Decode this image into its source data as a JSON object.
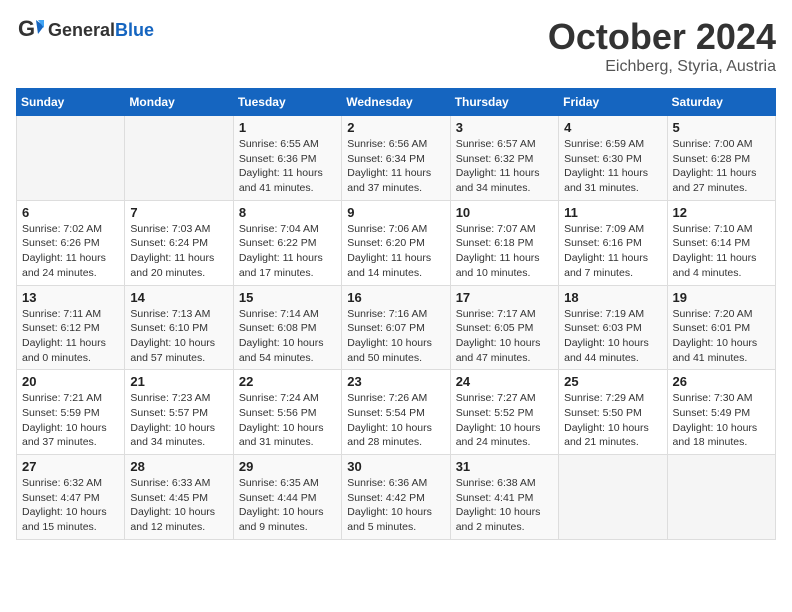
{
  "header": {
    "logo_general": "General",
    "logo_blue": "Blue",
    "month_title": "October 2024",
    "location": "Eichberg, Styria, Austria"
  },
  "days_of_week": [
    "Sunday",
    "Monday",
    "Tuesday",
    "Wednesday",
    "Thursday",
    "Friday",
    "Saturday"
  ],
  "weeks": [
    [
      {
        "day": "",
        "info": ""
      },
      {
        "day": "",
        "info": ""
      },
      {
        "day": "1",
        "info": "Sunrise: 6:55 AM\nSunset: 6:36 PM\nDaylight: 11 hours\nand 41 minutes."
      },
      {
        "day": "2",
        "info": "Sunrise: 6:56 AM\nSunset: 6:34 PM\nDaylight: 11 hours\nand 37 minutes."
      },
      {
        "day": "3",
        "info": "Sunrise: 6:57 AM\nSunset: 6:32 PM\nDaylight: 11 hours\nand 34 minutes."
      },
      {
        "day": "4",
        "info": "Sunrise: 6:59 AM\nSunset: 6:30 PM\nDaylight: 11 hours\nand 31 minutes."
      },
      {
        "day": "5",
        "info": "Sunrise: 7:00 AM\nSunset: 6:28 PM\nDaylight: 11 hours\nand 27 minutes."
      }
    ],
    [
      {
        "day": "6",
        "info": "Sunrise: 7:02 AM\nSunset: 6:26 PM\nDaylight: 11 hours\nand 24 minutes."
      },
      {
        "day": "7",
        "info": "Sunrise: 7:03 AM\nSunset: 6:24 PM\nDaylight: 11 hours\nand 20 minutes."
      },
      {
        "day": "8",
        "info": "Sunrise: 7:04 AM\nSunset: 6:22 PM\nDaylight: 11 hours\nand 17 minutes."
      },
      {
        "day": "9",
        "info": "Sunrise: 7:06 AM\nSunset: 6:20 PM\nDaylight: 11 hours\nand 14 minutes."
      },
      {
        "day": "10",
        "info": "Sunrise: 7:07 AM\nSunset: 6:18 PM\nDaylight: 11 hours\nand 10 minutes."
      },
      {
        "day": "11",
        "info": "Sunrise: 7:09 AM\nSunset: 6:16 PM\nDaylight: 11 hours\nand 7 minutes."
      },
      {
        "day": "12",
        "info": "Sunrise: 7:10 AM\nSunset: 6:14 PM\nDaylight: 11 hours\nand 4 minutes."
      }
    ],
    [
      {
        "day": "13",
        "info": "Sunrise: 7:11 AM\nSunset: 6:12 PM\nDaylight: 11 hours\nand 0 minutes."
      },
      {
        "day": "14",
        "info": "Sunrise: 7:13 AM\nSunset: 6:10 PM\nDaylight: 10 hours\nand 57 minutes."
      },
      {
        "day": "15",
        "info": "Sunrise: 7:14 AM\nSunset: 6:08 PM\nDaylight: 10 hours\nand 54 minutes."
      },
      {
        "day": "16",
        "info": "Sunrise: 7:16 AM\nSunset: 6:07 PM\nDaylight: 10 hours\nand 50 minutes."
      },
      {
        "day": "17",
        "info": "Sunrise: 7:17 AM\nSunset: 6:05 PM\nDaylight: 10 hours\nand 47 minutes."
      },
      {
        "day": "18",
        "info": "Sunrise: 7:19 AM\nSunset: 6:03 PM\nDaylight: 10 hours\nand 44 minutes."
      },
      {
        "day": "19",
        "info": "Sunrise: 7:20 AM\nSunset: 6:01 PM\nDaylight: 10 hours\nand 41 minutes."
      }
    ],
    [
      {
        "day": "20",
        "info": "Sunrise: 7:21 AM\nSunset: 5:59 PM\nDaylight: 10 hours\nand 37 minutes."
      },
      {
        "day": "21",
        "info": "Sunrise: 7:23 AM\nSunset: 5:57 PM\nDaylight: 10 hours\nand 34 minutes."
      },
      {
        "day": "22",
        "info": "Sunrise: 7:24 AM\nSunset: 5:56 PM\nDaylight: 10 hours\nand 31 minutes."
      },
      {
        "day": "23",
        "info": "Sunrise: 7:26 AM\nSunset: 5:54 PM\nDaylight: 10 hours\nand 28 minutes."
      },
      {
        "day": "24",
        "info": "Sunrise: 7:27 AM\nSunset: 5:52 PM\nDaylight: 10 hours\nand 24 minutes."
      },
      {
        "day": "25",
        "info": "Sunrise: 7:29 AM\nSunset: 5:50 PM\nDaylight: 10 hours\nand 21 minutes."
      },
      {
        "day": "26",
        "info": "Sunrise: 7:30 AM\nSunset: 5:49 PM\nDaylight: 10 hours\nand 18 minutes."
      }
    ],
    [
      {
        "day": "27",
        "info": "Sunrise: 6:32 AM\nSunset: 4:47 PM\nDaylight: 10 hours\nand 15 minutes."
      },
      {
        "day": "28",
        "info": "Sunrise: 6:33 AM\nSunset: 4:45 PM\nDaylight: 10 hours\nand 12 minutes."
      },
      {
        "day": "29",
        "info": "Sunrise: 6:35 AM\nSunset: 4:44 PM\nDaylight: 10 hours\nand 9 minutes."
      },
      {
        "day": "30",
        "info": "Sunrise: 6:36 AM\nSunset: 4:42 PM\nDaylight: 10 hours\nand 5 minutes."
      },
      {
        "day": "31",
        "info": "Sunrise: 6:38 AM\nSunset: 4:41 PM\nDaylight: 10 hours\nand 2 minutes."
      },
      {
        "day": "",
        "info": ""
      },
      {
        "day": "",
        "info": ""
      }
    ]
  ]
}
